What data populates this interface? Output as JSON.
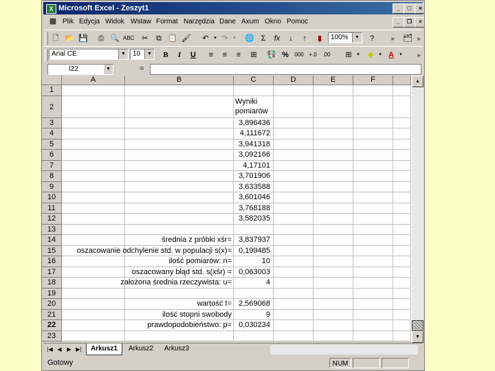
{
  "window": {
    "title": "Microsoft Excel - Zeszyt1"
  },
  "menu": [
    "Plik",
    "Edycja",
    "Widok",
    "Wstaw",
    "Format",
    "Narzędzia",
    "Dane",
    "Axum",
    "Okno",
    "Pomoc"
  ],
  "toolbar": {
    "zoom": "100%",
    "font": "Arial CE",
    "font_size": "10",
    "bold": "B",
    "italic": "I",
    "underline": "U",
    "percent": "%",
    "thousands": "000",
    "sigma": "Σ",
    "fx": "fx"
  },
  "formula_bar": {
    "name_box": "I22",
    "equals": "=",
    "formula": ""
  },
  "columns": [
    "A",
    "B",
    "C",
    "D",
    "E",
    "F"
  ],
  "rows": [
    {
      "n": "1",
      "b": "",
      "c": ""
    },
    {
      "n": "2",
      "b": "",
      "c": "Wyniki pomiarów"
    },
    {
      "n": "3",
      "b": "",
      "c": "3,896436"
    },
    {
      "n": "4",
      "b": "",
      "c": "4,111672"
    },
    {
      "n": "5",
      "b": "",
      "c": "3,941318"
    },
    {
      "n": "6",
      "b": "",
      "c": "3,092166"
    },
    {
      "n": "7",
      "b": "",
      "c": "4,17101"
    },
    {
      "n": "8",
      "b": "",
      "c": "3,701906"
    },
    {
      "n": "9",
      "b": "",
      "c": "3,633588"
    },
    {
      "n": "10",
      "b": "",
      "c": "3,601046"
    },
    {
      "n": "11",
      "b": "",
      "c": "3,768188"
    },
    {
      "n": "12",
      "b": "",
      "c": "3,582035"
    },
    {
      "n": "13",
      "b": "",
      "c": ""
    },
    {
      "n": "14",
      "b": "średnia z próbki xśr=",
      "c": "3,837937"
    },
    {
      "n": "15",
      "b": "oszacowanie odchylenie std. w populacji s(x)=",
      "c": "0,199485"
    },
    {
      "n": "16",
      "b": "ilość pomiarów: n=",
      "c": "10"
    },
    {
      "n": "17",
      "b": "oszacowany błąd std. s(xśr) =",
      "c": "0,063003"
    },
    {
      "n": "18",
      "b": "założona średnia rzeczywista: u=",
      "c": "4"
    },
    {
      "n": "19",
      "b": "",
      "c": ""
    },
    {
      "n": "20",
      "b": "wartość t=",
      "c": "2,569068"
    },
    {
      "n": "21",
      "b": "ilość stopni swobody",
      "c": "9"
    },
    {
      "n": "22",
      "b": "prawdopodobieństwo: p=",
      "c": "0,030234"
    },
    {
      "n": "23",
      "b": "",
      "c": ""
    }
  ],
  "sheet_tabs": [
    "Arkusz1",
    "Arkusz2",
    "Arkusz3"
  ],
  "status": {
    "text": "Gotowy",
    "num": "NUM"
  }
}
